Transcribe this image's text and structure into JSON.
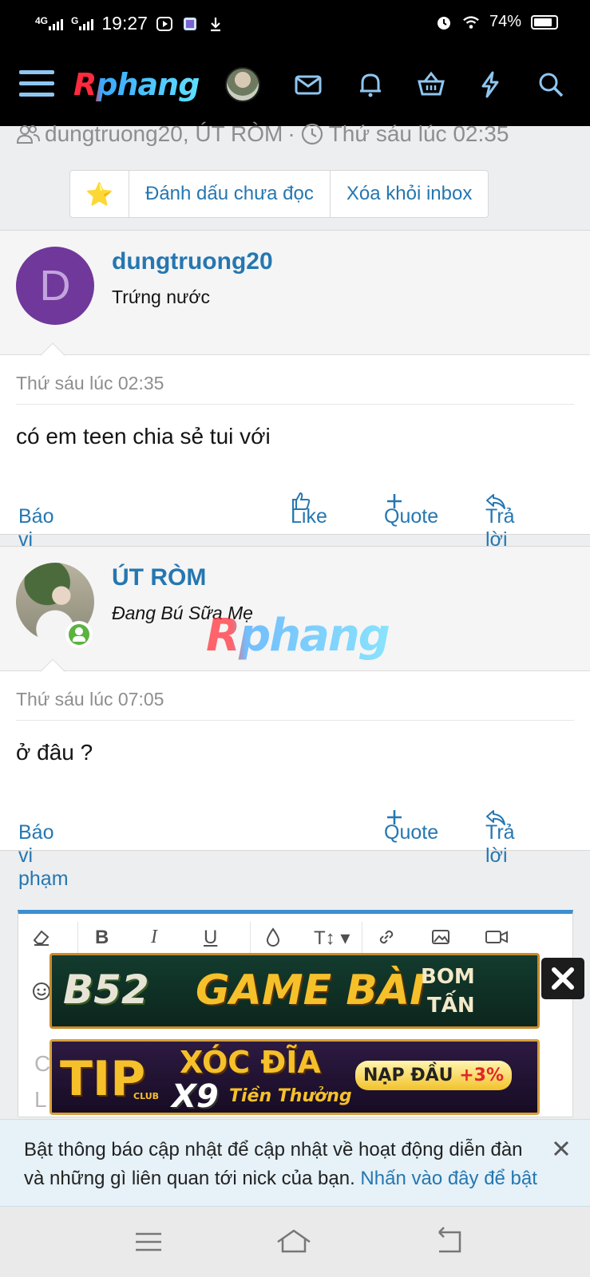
{
  "status_bar": {
    "net1": "4G",
    "net2": "G",
    "time": "19:27",
    "battery": "74%",
    "battery_level": 0.74,
    "icons": [
      "media-icon",
      "app-icon",
      "download-icon",
      "alarm-icon",
      "wifi-icon",
      "battery-icon"
    ]
  },
  "header": {
    "logo": "Rphang",
    "icons": [
      "menu-icon",
      "avatar",
      "mail-icon",
      "bell-icon",
      "basket-icon",
      "lightning-icon",
      "search-icon"
    ],
    "menu_color": "#8fc6f0"
  },
  "thread": {
    "participants": "dungtruong20, ÚT RÒM",
    "separator": "·",
    "time": "Thứ sáu lúc 02:35"
  },
  "actions_bar": {
    "star": "⭐",
    "mark_unread": "Đánh dấu chưa đọc",
    "remove_inbox": "Xóa khỏi inbox"
  },
  "messages": [
    {
      "author": "dungtruong20",
      "avatar_letter": "D",
      "avatar_color": "#70389b",
      "user_title": "Trứng nước",
      "date": "Thứ sáu lúc 02:35",
      "text": "có em teen chia sẻ tui với",
      "report": "Báo vi phạm",
      "like": "Like",
      "quote": "Quote",
      "reply": "Trả lời"
    },
    {
      "author": "ÚT RÒM",
      "user_title": "Đang Bú Sữa Mẹ",
      "date": "Thứ sáu lúc 07:05",
      "text": "ở đâu ?",
      "report": "Báo vi phạm",
      "quote": "Quote",
      "reply": "Trả lời"
    }
  ],
  "watermark": "Rphang",
  "editor": {
    "toolbar": [
      "eraser-icon",
      "bold-icon",
      "italic-icon",
      "underline-icon",
      "color-icon",
      "text-size-icon",
      "link-icon",
      "image-icon",
      "video-icon",
      "emoji-icon"
    ],
    "bold": "B",
    "italic": "I",
    "underline": "U",
    "textsize": "T↕",
    "placeholder_line1": "C",
    "placeholder_line2": "L"
  },
  "ads": {
    "ad1": {
      "brand": "B52",
      "title": "GAME BÀI",
      "tag1": "BOM",
      "tag2": "TẤN"
    },
    "ad2": {
      "brand": "TIP",
      "club": "CLUB",
      "title": "XÓC ĐĨA",
      "sub_brand": "X9",
      "sub": "Tiền Thưởng",
      "pill": "NẠP ĐẦU",
      "bonus": "+3%"
    }
  },
  "notification": {
    "text": "Bật thông báo cập nhật để cập nhật về hoạt động diễn đàn và những gì liên quan tới nick của bạn.",
    "link": "Nhấn vào đây để bật"
  },
  "system_nav": [
    "recents-icon",
    "home-icon",
    "back-icon"
  ]
}
